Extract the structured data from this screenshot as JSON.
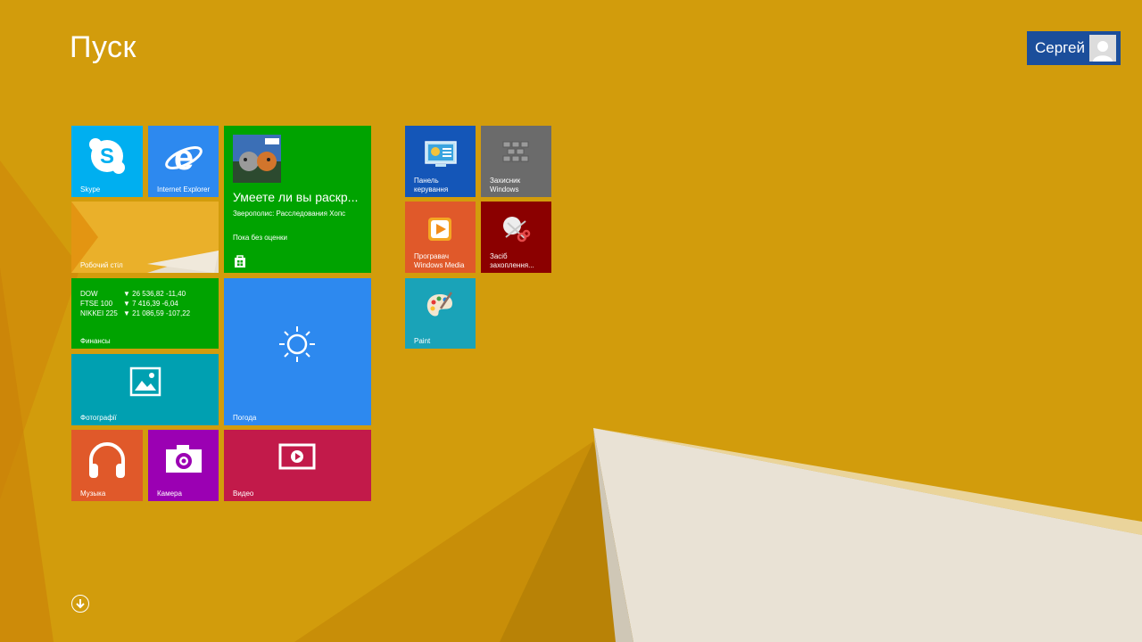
{
  "start": {
    "title": "Пуск"
  },
  "user": {
    "name": "Сергей",
    "icon": "user-avatar-icon"
  },
  "colors": {
    "background": "#d19a0a",
    "skype": "#00aff0",
    "ie": "#2d89ef",
    "desktop": "#e8a317",
    "store": "#00a300",
    "finance": "#00a300",
    "photos": "#00a0b1",
    "weather": "#2d89ef",
    "music": "#e0592a",
    "camera": "#9b00b3",
    "video": "#c21a4a",
    "control_panel": "#1456b8",
    "defender": "#6b6b6b",
    "media_player": "#e0592a",
    "snipping": "#8b0000",
    "paint": "#1aa3b8"
  },
  "tiles": {
    "skype": {
      "label": "Skype",
      "icon": "skype-icon"
    },
    "ie": {
      "label": "Internet Explorer",
      "icon": "internet-explorer-icon"
    },
    "desktop": {
      "label": "Робочий стіл"
    },
    "store": {
      "title": "Умеете ли вы раскр...",
      "subtitle": "Зверополис: Расследования Хопс",
      "rating": "Пока без оценки",
      "icon": "store-bag-icon"
    },
    "finance": {
      "label": "Финансы",
      "rows": [
        {
          "name": "DOW",
          "value": "▼ 26 536,82 -11,40"
        },
        {
          "name": "FTSE 100",
          "value": "▼ 7 416,39 -6,04"
        },
        {
          "name": "NIKKEI 225",
          "value": "▼ 21 086,59 -107,22"
        }
      ]
    },
    "photos": {
      "label": "Фотографії",
      "icon": "photo-icon"
    },
    "weather": {
      "label": "Погода",
      "icon": "sun-icon"
    },
    "music": {
      "label": "Музыка",
      "icon": "headphones-icon"
    },
    "camera": {
      "label": "Камера",
      "icon": "camera-icon"
    },
    "video": {
      "label": "Видео",
      "icon": "video-play-icon"
    },
    "control_panel": {
      "label_line1": "Панель",
      "label_line2": "керування",
      "icon": "control-panel-icon"
    },
    "defender": {
      "label_line1": "Захисник",
      "label_line2": "Windows",
      "icon": "defender-wall-icon"
    },
    "media_player": {
      "label_line1": "Програвач",
      "label_line2": "Windows Media",
      "icon": "media-player-icon"
    },
    "snipping": {
      "label_line1": "Засіб",
      "label_line2": "захоплення...",
      "icon": "scissors-icon"
    },
    "paint": {
      "label": "Paint",
      "icon": "paint-palette-icon"
    }
  },
  "apps_button": {
    "icon": "arrow-down-circle-icon"
  }
}
